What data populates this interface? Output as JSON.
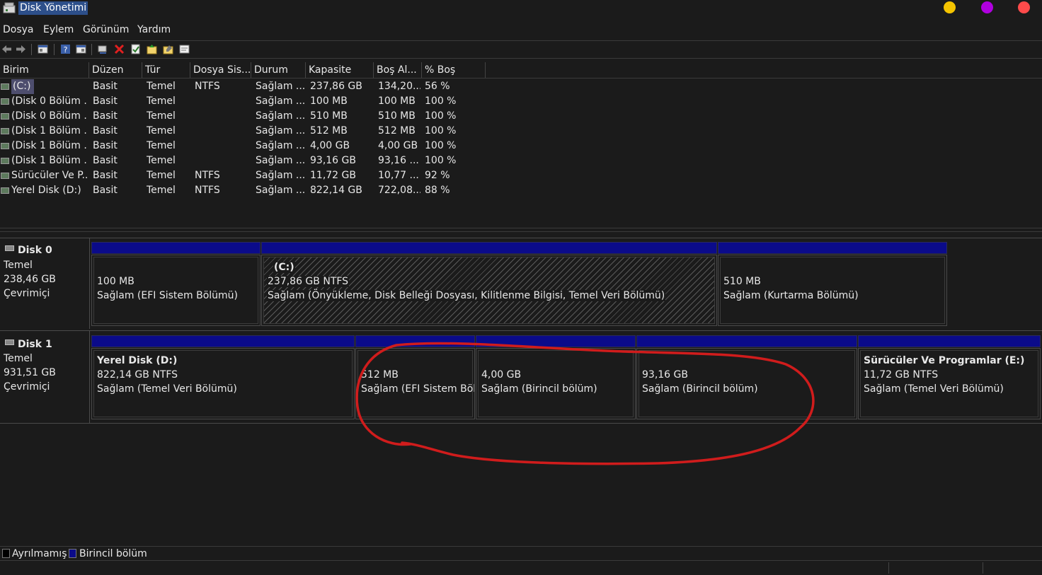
{
  "window": {
    "title": "Disk Yönetimi",
    "controls": [
      "minimize-dot",
      "maximize-dot",
      "close-dot"
    ],
    "control_colors": {
      "minimize": "#f5c400",
      "maximize": "#b000e0",
      "close": "#ff4b4b"
    }
  },
  "menu": [
    "Dosya",
    "Eylem",
    "Görünüm",
    "Yardım"
  ],
  "toolbar": [
    "back-icon",
    "forward-icon",
    "properties-panel-icon",
    "help-icon",
    "console-icon",
    "connect-icon",
    "delete-icon",
    "check-icon",
    "folder-up-icon",
    "folder-edit-icon",
    "window-icon"
  ],
  "volume_list": {
    "columns": [
      "Birim",
      "Düzen",
      "Tür",
      "Dosya Sis...",
      "Durum",
      "Kapasite",
      "Boş Al...",
      "% Boş"
    ],
    "rows": [
      [
        "(C:)",
        "Basit",
        "Temel",
        "NTFS",
        "Sağlam ...",
        "237,86 GB",
        "134,20...",
        "56 %"
      ],
      [
        "(Disk 0 Bölüm ...",
        "Basit",
        "Temel",
        "",
        "Sağlam ...",
        "100 MB",
        "100 MB",
        "100 %"
      ],
      [
        "(Disk 0 Bölüm ...",
        "Basit",
        "Temel",
        "",
        "Sağlam ...",
        "510 MB",
        "510 MB",
        "100 %"
      ],
      [
        "(Disk 1 Bölüm ...",
        "Basit",
        "Temel",
        "",
        "Sağlam ...",
        "512 MB",
        "512 MB",
        "100 %"
      ],
      [
        "(Disk 1 Bölüm ...",
        "Basit",
        "Temel",
        "",
        "Sağlam ...",
        "4,00 GB",
        "4,00 GB",
        "100 %"
      ],
      [
        "(Disk 1 Bölüm ...",
        "Basit",
        "Temel",
        "",
        "Sağlam ...",
        "93,16 GB",
        "93,16 ...",
        "100 %"
      ],
      [
        "Sürücüler Ve P...",
        "Basit",
        "Temel",
        "NTFS",
        "Sağlam ...",
        "11,72 GB",
        "10,77 ...",
        "92 %"
      ],
      [
        "Yerel Disk (D:)",
        "Basit",
        "Temel",
        "NTFS",
        "Sağlam ...",
        "822,14 GB",
        "722,08...",
        "88 %"
      ]
    ]
  },
  "disks": [
    {
      "name": "Disk 0",
      "type": "Temel",
      "size": "238,46 GB",
      "status": "Çevrimiçi",
      "partitions": [
        {
          "title": "",
          "line1": "100 MB",
          "line2": "Sağlam (EFI Sistem Bölümü)"
        },
        {
          "title": "(C:)",
          "line1": "237,86 GB NTFS",
          "line2": "Sağlam (Önyükleme, Disk Belleği Dosyası, Kilitlenme Bilgisi, Temel Veri Bölümü)"
        },
        {
          "title": "",
          "line1": "510 MB",
          "line2": "Sağlam (Kurtarma Bölümü)"
        }
      ]
    },
    {
      "name": "Disk 1",
      "type": "Temel",
      "size": "931,51 GB",
      "status": "Çevrimiçi",
      "partitions": [
        {
          "title": "Yerel Disk  (D:)",
          "line1": "822,14 GB NTFS",
          "line2": "Sağlam (Temel Veri Bölümü)"
        },
        {
          "title": "",
          "line1": "512 MB",
          "line2": "Sağlam (EFI Sistem Bölü"
        },
        {
          "title": "",
          "line1": "4,00 GB",
          "line2": "Sağlam (Birincil bölüm)"
        },
        {
          "title": "",
          "line1": "93,16 GB",
          "line2": "Sağlam (Birincil bölüm)"
        },
        {
          "title": "Sürücüler Ve Programlar  (E:)",
          "line1": "11,72 GB NTFS",
          "line2": "Sağlam (Temel Veri Bölümü)"
        }
      ]
    }
  ],
  "legend": {
    "unallocated": "Ayrılmamış",
    "primary": "Birincil bölüm",
    "unallocated_color": "#000000",
    "primary_color": "#0b0b8a"
  },
  "annotation": {
    "color": "#d01c1c",
    "shape": "hand-drawn circle around Disk 1 partitions 2–4"
  }
}
